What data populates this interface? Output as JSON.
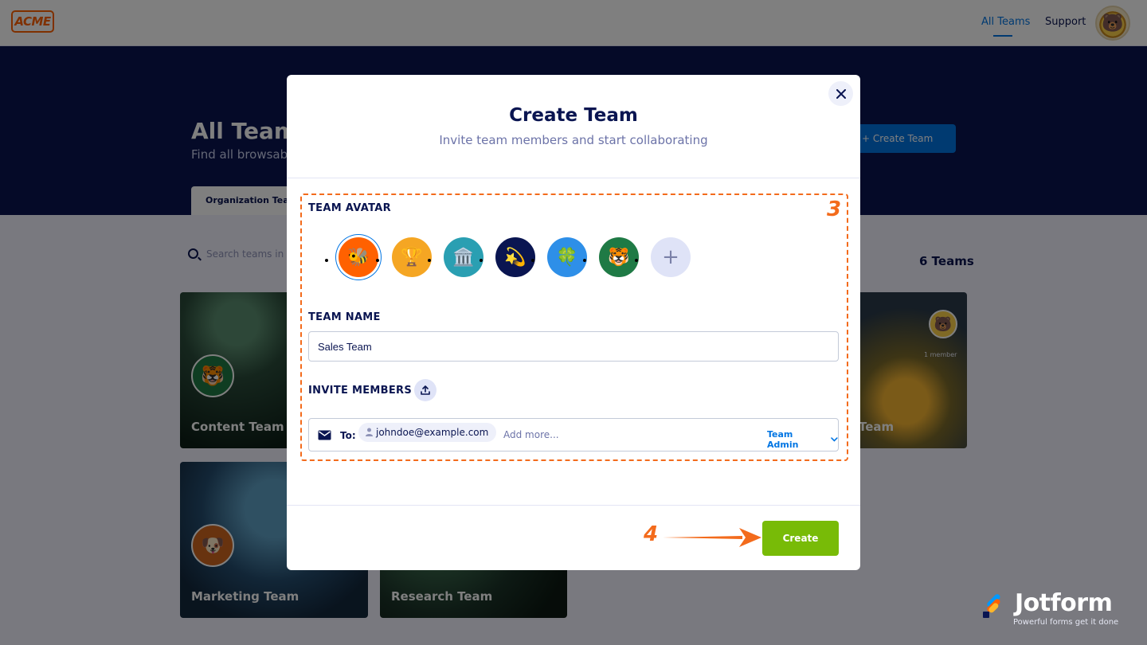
{
  "header": {
    "logo_text": "ACME",
    "nav": {
      "all_teams": "All Teams",
      "support": "Support"
    },
    "user_avatar_emoji": "🐻"
  },
  "hero": {
    "title": "All Teams",
    "subtitle": "Find all browsab",
    "create_button": "+ Create Team",
    "tab_label": "Organization Team"
  },
  "search": {
    "placeholder": "Search teams in y"
  },
  "team_count": "6 Teams",
  "teams": [
    {
      "name": "Content Team",
      "avatar_emoji": "🐯"
    },
    {
      "name": "Team",
      "avatar_emoji": "🐻",
      "sub": "1 member"
    },
    {
      "name": "Marketing Team",
      "avatar_emoji": "🐶"
    },
    {
      "name": "Research Team"
    }
  ],
  "modal": {
    "title": "Create Team",
    "subtitle": "Invite team members and start collaborating",
    "avatar_label": "TEAM AVATAR",
    "avatars": [
      {
        "emoji": "🐝",
        "color": "#ff6100",
        "selected": true
      },
      {
        "emoji": "🏆",
        "color": "#f5a623",
        "selected": false
      },
      {
        "emoji": "🏛️",
        "color": "#2a9fb2",
        "selected": false
      },
      {
        "emoji": "💫",
        "color": "#0a1551",
        "selected": false
      },
      {
        "emoji": "🍀",
        "color": "#2e8fe8",
        "selected": false
      },
      {
        "emoji": "🐯",
        "color": "#1f7a45",
        "selected": false
      },
      {
        "emoji": "+",
        "color": "#dfe3f7",
        "selected": false
      }
    ],
    "name_label": "TEAM NAME",
    "team_name_value": "Sales Team",
    "invite_label": "INVITE MEMBERS",
    "invite": {
      "to_label": "To:",
      "emails": [
        "johndoe@example.com"
      ],
      "add_more_placeholder": "Add more...",
      "role": "Team Admin"
    },
    "create_button": "Create"
  },
  "annotations": {
    "step_3": "3",
    "step_4": "4",
    "color": "#f36b1c"
  },
  "brand": {
    "name": "Jotform",
    "tagline": "Powerful forms get it done"
  },
  "colors": {
    "accent": "#0075e3",
    "create": "#78bb07",
    "navy": "#0a1551"
  }
}
